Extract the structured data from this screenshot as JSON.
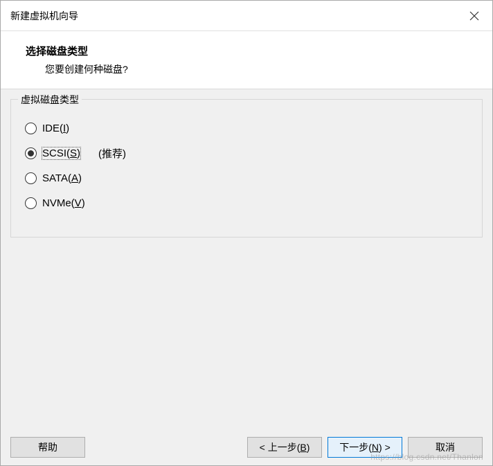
{
  "titlebar": {
    "title": "新建虚拟机向导"
  },
  "header": {
    "title": "选择磁盘类型",
    "subtitle": "您要创建何种磁盘?"
  },
  "group": {
    "legend": "虚拟磁盘类型",
    "options": [
      {
        "label_pre": "IDE(",
        "mnemonic": "I",
        "label_post": ")",
        "selected": false,
        "suffix": ""
      },
      {
        "label_pre": "SCSI(",
        "mnemonic": "S",
        "label_post": ")",
        "selected": true,
        "suffix": "(推荐)"
      },
      {
        "label_pre": "SATA(",
        "mnemonic": "A",
        "label_post": ")",
        "selected": false,
        "suffix": ""
      },
      {
        "label_pre": "NVMe(",
        "mnemonic": "V",
        "label_post": ")",
        "selected": false,
        "suffix": ""
      }
    ]
  },
  "footer": {
    "help": "帮助",
    "back_pre": "< 上一步(",
    "back_m": "B",
    "back_post": ")",
    "next_pre": "下一步(",
    "next_m": "N",
    "next_post": ") >",
    "cancel": "取消"
  },
  "watermark": "https://blog.csdn.net/Thanlon"
}
